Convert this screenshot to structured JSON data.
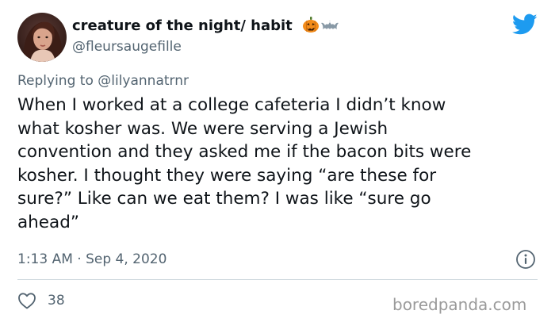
{
  "author": {
    "display_name": "creature of the night/ habit",
    "handle": "@fleursaugefille",
    "emoji_icons": [
      "jack-o-lantern-icon",
      "bat-icon"
    ]
  },
  "reply": {
    "prefix": "Replying to",
    "mention": "@lilyannatrnr"
  },
  "tweet": {
    "text_lines": [
      "When I worked at a college cafeteria I didn’t know",
      "what kosher was. We were serving a Jewish",
      "convention and they asked me if the bacon bits were",
      "kosher. I thought they were saying “are these for",
      "sure?” Like can we eat them? I was like “sure go",
      "ahead”"
    ],
    "timestamp": "1:13 AM · Sep 4, 2020"
  },
  "actions": {
    "like_count": "38"
  },
  "watermark": "boredpanda.com",
  "colors": {
    "twitter_blue": "#1d9bf0",
    "secondary_text": "#536471",
    "primary_text": "#0f1419",
    "divider": "#cfd9de",
    "pumpkin": "#f28c1b"
  }
}
